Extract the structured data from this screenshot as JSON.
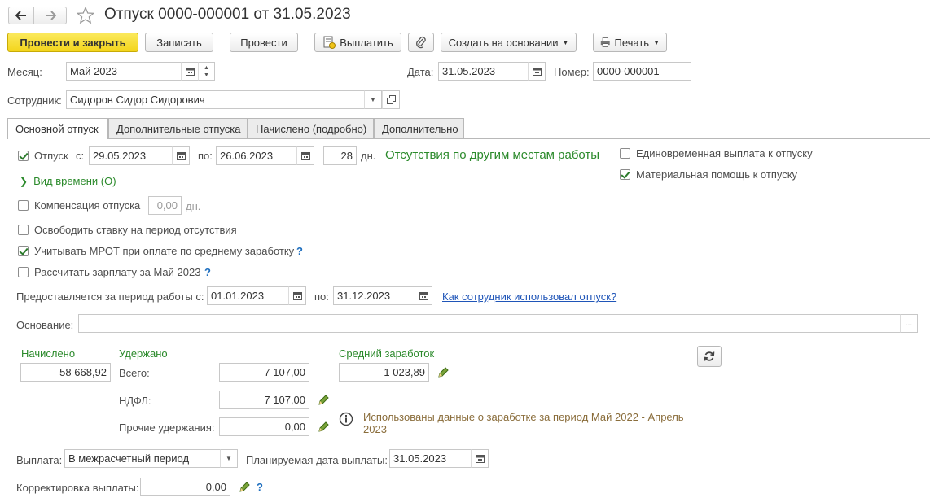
{
  "header": {
    "title": "Отпуск 0000-000001 от 31.05.2023",
    "back_icon": "arrow-left",
    "forward_icon": "arrow-right",
    "star_icon": "star"
  },
  "toolbar": {
    "post_close": "Провести и закрыть",
    "save": "Записать",
    "post": "Провести",
    "pay": "Выплатить",
    "create_based": "Создать на основании",
    "print": "Печать"
  },
  "fields": {
    "month_label": "Месяц:",
    "month_value": "Май 2023",
    "date_label": "Дата:",
    "date_value": "31.05.2023",
    "number_label": "Номер:",
    "number_value": "0000-000001",
    "employee_label": "Сотрудник:",
    "employee_value": "Сидоров Сидор Сидорович"
  },
  "tabs": [
    "Основной отпуск",
    "Дополнительные отпуска",
    "Начислено (подробно)",
    "Дополнительно"
  ],
  "vacation": {
    "checkbox_label": "Отпуск",
    "checked": true,
    "from_label": "с:",
    "from_value": "29.05.2023",
    "to_label": "по:",
    "to_value": "26.06.2023",
    "days_value": "28",
    "days_unit": "дн.",
    "absence_link": "Отсутствия по другим местам работы",
    "time_kind": "Вид времени (О)"
  },
  "right_options": {
    "one_time_label": "Единовременная выплата к отпуску",
    "one_time_checked": false,
    "aid_label": "Материальная помощь к отпуску",
    "aid_checked": true
  },
  "options": {
    "compensation_label": "Компенсация отпуска",
    "compensation_checked": false,
    "compensation_value": "0,00",
    "compensation_unit": "дн.",
    "release_rate_label": "Освободить ставку на период отсутствия",
    "release_rate_checked": false,
    "mrot_label": "Учитывать МРОТ при оплате по среднему заработку",
    "mrot_checked": true,
    "salary_label": "Рассчитать зарплату за Май 2023",
    "salary_checked": false,
    "help_mark": "?"
  },
  "work_period": {
    "label": "Предоставляется за период работы с:",
    "from_value": "01.01.2023",
    "to_label": "по:",
    "to_value": "31.12.2023",
    "usage_link": "Как сотрудник использовал отпуск?"
  },
  "basis": {
    "label": "Основание:",
    "value": "",
    "more": "..."
  },
  "totals": {
    "accrued_label": "Начислено",
    "accrued_value": "58 668,92",
    "withheld_label": "Удержано",
    "total_label": "Всего:",
    "total_value": "7 107,00",
    "ndfl_label": "НДФЛ:",
    "ndfl_value": "7 107,00",
    "other_label": "Прочие удержания:",
    "other_value": "0,00",
    "avg_label": "Средний заработок",
    "avg_value": "1 023,89",
    "info_text_line1": "Использованы данные о заработке за период Май 2022 - Апрель",
    "info_text_line2": "2023"
  },
  "payment": {
    "label": "Выплата:",
    "value": "В межрасчетный период",
    "planned_label": "Планируемая дата выплаты:",
    "planned_value": "31.05.2023",
    "correction_label": "Корректировка выплаты:",
    "correction_value": "0,00",
    "help_mark": "?"
  },
  "colors": {
    "accent_yellow": "#f3d51c",
    "green_text": "#2b8a2b",
    "link_blue": "#1f55b8"
  }
}
